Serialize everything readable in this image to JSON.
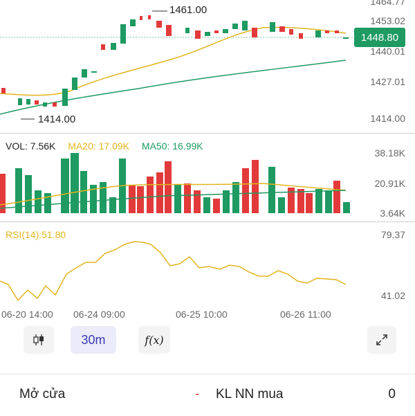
{
  "price_panel": {
    "axis_labels": [
      "1464.77",
      "1453.02",
      "1440.01",
      "1427.01",
      "1414.00"
    ],
    "current_price": "1448.80",
    "high_marker": "1461.00",
    "low_marker": "1414.00"
  },
  "volume_panel": {
    "legend": {
      "vol": "VOL: 7.56K",
      "ma20": "MA20: 17.09K",
      "ma50": "MA50: 16.99K"
    },
    "axis_labels": [
      "38.18K",
      "20.91K",
      "3.64K"
    ]
  },
  "rsi_panel": {
    "legend": "RSI(14):51.80",
    "axis_labels": [
      "79.37",
      "41.02"
    ]
  },
  "time_labels": [
    "06-20 14:00",
    "06-24 09:00",
    "06-25 10:00",
    "06-26 11:00"
  ],
  "toolbar": {
    "candle_icon": "candlestick-icon",
    "interval_label": "30m",
    "indicator_label": "f(x)",
    "expand_icon": "expand-icon"
  },
  "footer": {
    "open_label": "Mở cửa",
    "open_value": "-",
    "foreign_buy_label": "KL NN mua",
    "foreign_buy_value": "0"
  },
  "colors": {
    "up": "#1e9a62",
    "down": "#e23a3a",
    "ma_yellow": "#e0b41f",
    "ma_green": "#1e9a62",
    "rsi": "#e0b41f",
    "accent_bg": "#ebebf9",
    "accent_text": "#3b3bb5"
  }
}
